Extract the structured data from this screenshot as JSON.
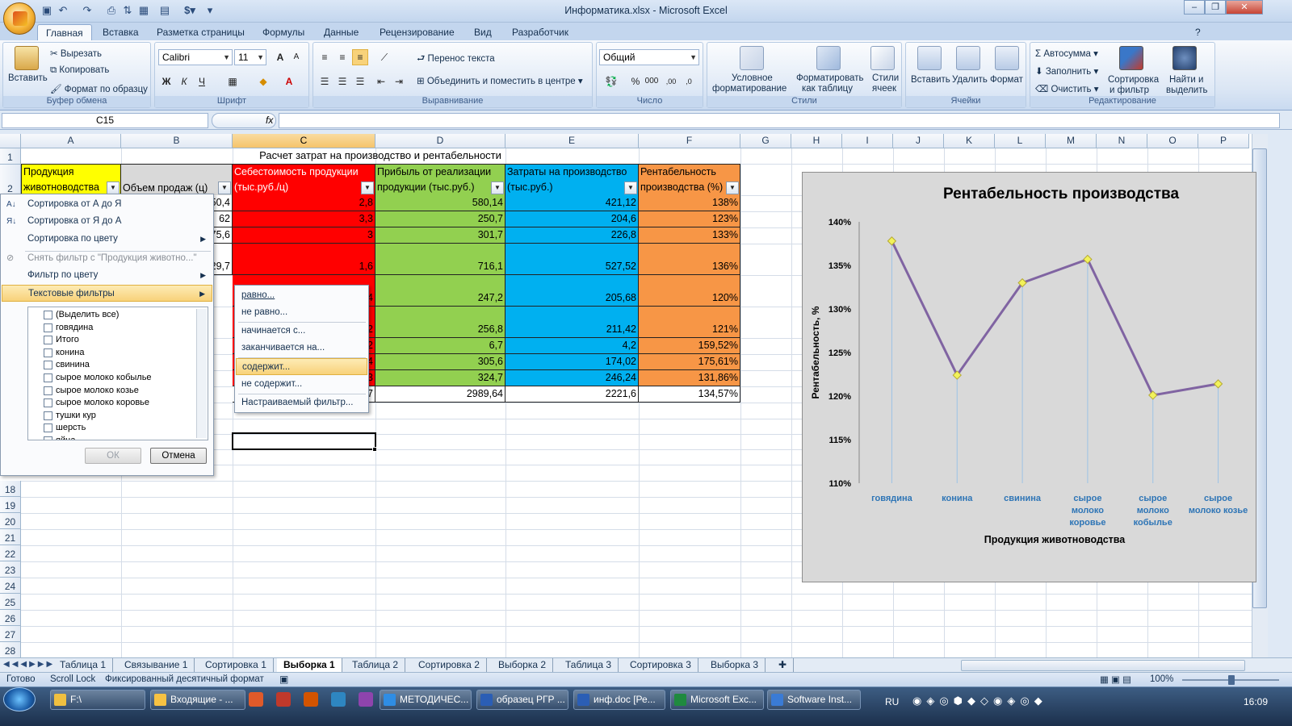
{
  "window": {
    "title": "Информатика.xlsx - Microsoft Excel"
  },
  "tabs": [
    "Главная",
    "Вставка",
    "Разметка страницы",
    "Формулы",
    "Данные",
    "Рецензирование",
    "Вид",
    "Разработчик"
  ],
  "ribbon": {
    "clipboard": {
      "label": "Буфер обмена",
      "paste": "Вставить",
      "cut": "Вырезать",
      "copy": "Копировать",
      "format_painter": "Формат по образцу"
    },
    "font": {
      "label": "Шрифт",
      "name": "Calibri",
      "size": "11"
    },
    "alignment": {
      "label": "Выравнивание",
      "wrap": "Перенос текста",
      "merge": "Объединить и поместить в центре"
    },
    "number": {
      "label": "Число",
      "format": "Общий"
    },
    "styles": {
      "label": "Стили",
      "conditional1": "Условное",
      "conditional2": "форматирование",
      "as_table1": "Форматировать",
      "as_table2": "как таблицу",
      "cell_styles1": "Стили",
      "cell_styles2": "ячеек"
    },
    "cells": {
      "label": "Ячейки",
      "insert": "Вставить",
      "delete": "Удалить",
      "format": "Формат"
    },
    "editing": {
      "label": "Редактирование",
      "autosum": "Автосумма",
      "fill": "Заполнить",
      "clear": "Очистить",
      "sort1": "Сортировка",
      "sort2": "и фильтр",
      "find1": "Найти и",
      "find2": "выделить"
    }
  },
  "namebox": "C15",
  "fx_label": "fx",
  "columns": [
    "A",
    "B",
    "C",
    "D",
    "E",
    "F",
    "G",
    "H",
    "I",
    "J",
    "K",
    "L",
    "M",
    "N",
    "O",
    "P"
  ],
  "rows": [
    "1",
    "2",
    "18",
    "19",
    "20",
    "21",
    "22",
    "23",
    "24",
    "25",
    "26",
    "27",
    "28"
  ],
  "sheet": {
    "title": "Расчет затрат на производство и рентабельности",
    "headers": {
      "a1": "Продукция",
      "a2": "животноводства",
      "b": "Объем продаж (ц)",
      "c1": "Себестоимость продукции",
      "c2": "(тыс.руб./ц)",
      "d1": "Прибыль от реализации",
      "d2": "продукции (тыс.руб.)",
      "e1": "Затраты на производство",
      "e2": "(тыс.руб.)",
      "f1": "Рентабельность",
      "f2": "производства (%)"
    },
    "b_visible": [
      "50,4",
      "62",
      "75,6",
      "29,7"
    ],
    "c_values": [
      "2,8",
      "3,3",
      "3",
      "1,6",
      "4",
      "2",
      "2",
      "4",
      "3"
    ],
    "d_values": [
      "580,14",
      "250,7",
      "301,7",
      "716,1",
      "247,2",
      "256,8",
      "6,7",
      "305,6",
      "324,7",
      "2989,64"
    ],
    "e_values": [
      "421,12",
      "204,6",
      "226,8",
      "527,52",
      "205,68",
      "211,42",
      "4,2",
      "174,02",
      "246,24",
      "2221,6"
    ],
    "f_values": [
      "138%",
      "123%",
      "133%",
      "136%",
      "120%",
      "121%",
      "159,52%",
      "175,61%",
      "131,86%",
      "134,57%"
    ],
    "c_total_tail": "7"
  },
  "filter_menu": {
    "items": [
      "Сортировка от А до Я",
      "Сортировка от Я до А",
      "Сортировка по цвету",
      "Снять фильтр с \"Продукция животно...\"",
      "Фильтр по цвету",
      "Текстовые фильтры"
    ],
    "list": [
      "(Выделить все)",
      "говядина",
      "Итого",
      "конина",
      "свинина",
      "сырое молоко кобылье",
      "сырое молоко козье",
      "сырое молоко коровье",
      "тушки кур",
      "шерсть",
      "яйца"
    ],
    "ok": "ОК",
    "cancel": "Отмена"
  },
  "text_filters": [
    "равно...",
    "не равно...",
    "начинается с...",
    "заканчивается на...",
    "содержит...",
    "не содержит...",
    "Настраиваемый фильтр..."
  ],
  "chart_data": {
    "type": "line",
    "title": "Рентабельность производства",
    "xlabel": "Продукция животноводства",
    "ylabel": "Рентабельность, %",
    "categories": [
      "говядина",
      "конина",
      "свинина",
      "сырое молоко коровье",
      "сырое молоко кобылье",
      "сырое молоко козье"
    ],
    "category_lines": [
      [
        "говядина"
      ],
      [
        "конина"
      ],
      [
        "свинина"
      ],
      [
        "сырое",
        "молоко",
        "коровье"
      ],
      [
        "сырое",
        "молоко",
        "кобылье"
      ],
      [
        "сырое",
        "молоко козье"
      ]
    ],
    "values": [
      137.8,
      122.4,
      133.0,
      135.7,
      120.1,
      121.4
    ],
    "ylim": [
      110,
      140
    ],
    "yticks": [
      "110%",
      "115%",
      "120%",
      "125%",
      "130%",
      "135%",
      "140%"
    ],
    "line_color": "#8064a2",
    "marker_color": "#f2f25a",
    "grid": false
  },
  "sheet_tabs": [
    "Таблица 1",
    "Связывание 1",
    "Сортировка 1",
    "Выборка 1",
    "Таблица 2",
    "Сортировка 2",
    "Выборка 2",
    "Таблица 3",
    "Сортировка 3",
    "Выборка 3"
  ],
  "status": {
    "ready": "Готово",
    "scroll": "Scroll Lock",
    "fixed": "Фиксированный десятичный формат",
    "zoom": "100%"
  },
  "taskbar": {
    "items": [
      "F:\\",
      "Входящие - ...",
      "МЕТОДИЧЕС...",
      "образец РГР ...",
      "инф.doc [Ре...",
      "Microsoft Exc...",
      "Software Inst..."
    ],
    "lang": "RU",
    "time": "16:09"
  }
}
